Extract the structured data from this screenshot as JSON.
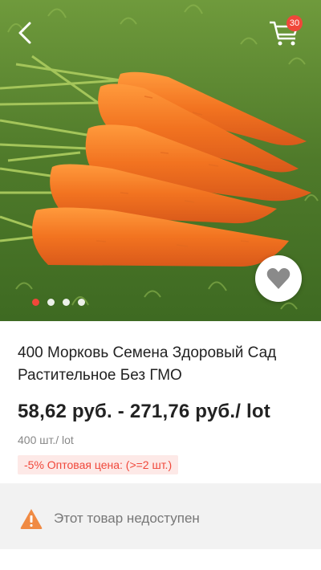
{
  "gallery": {
    "image_icon": "carrots-photo",
    "slide_count": 4,
    "active_slide": 0
  },
  "header": {
    "back_icon": "chevron-left-icon",
    "cart_icon": "cart-icon",
    "cart_count": "30"
  },
  "favorite_icon": "heart-icon",
  "product": {
    "title": "400 Морковь Семена Здоровый Сад Растительное Без ГМО",
    "price": "58,62 руб. - 271,76 руб./ lot",
    "unit": "400 шт./ lot",
    "promo": "-5% Оптовая цена: (>=2 шт.)"
  },
  "availability": {
    "icon": "warning-icon",
    "text": "Этот товар недоступен"
  },
  "colors": {
    "accent": "#f0473a",
    "promo_bg": "#fde9e7",
    "warning": "#f08a43"
  }
}
